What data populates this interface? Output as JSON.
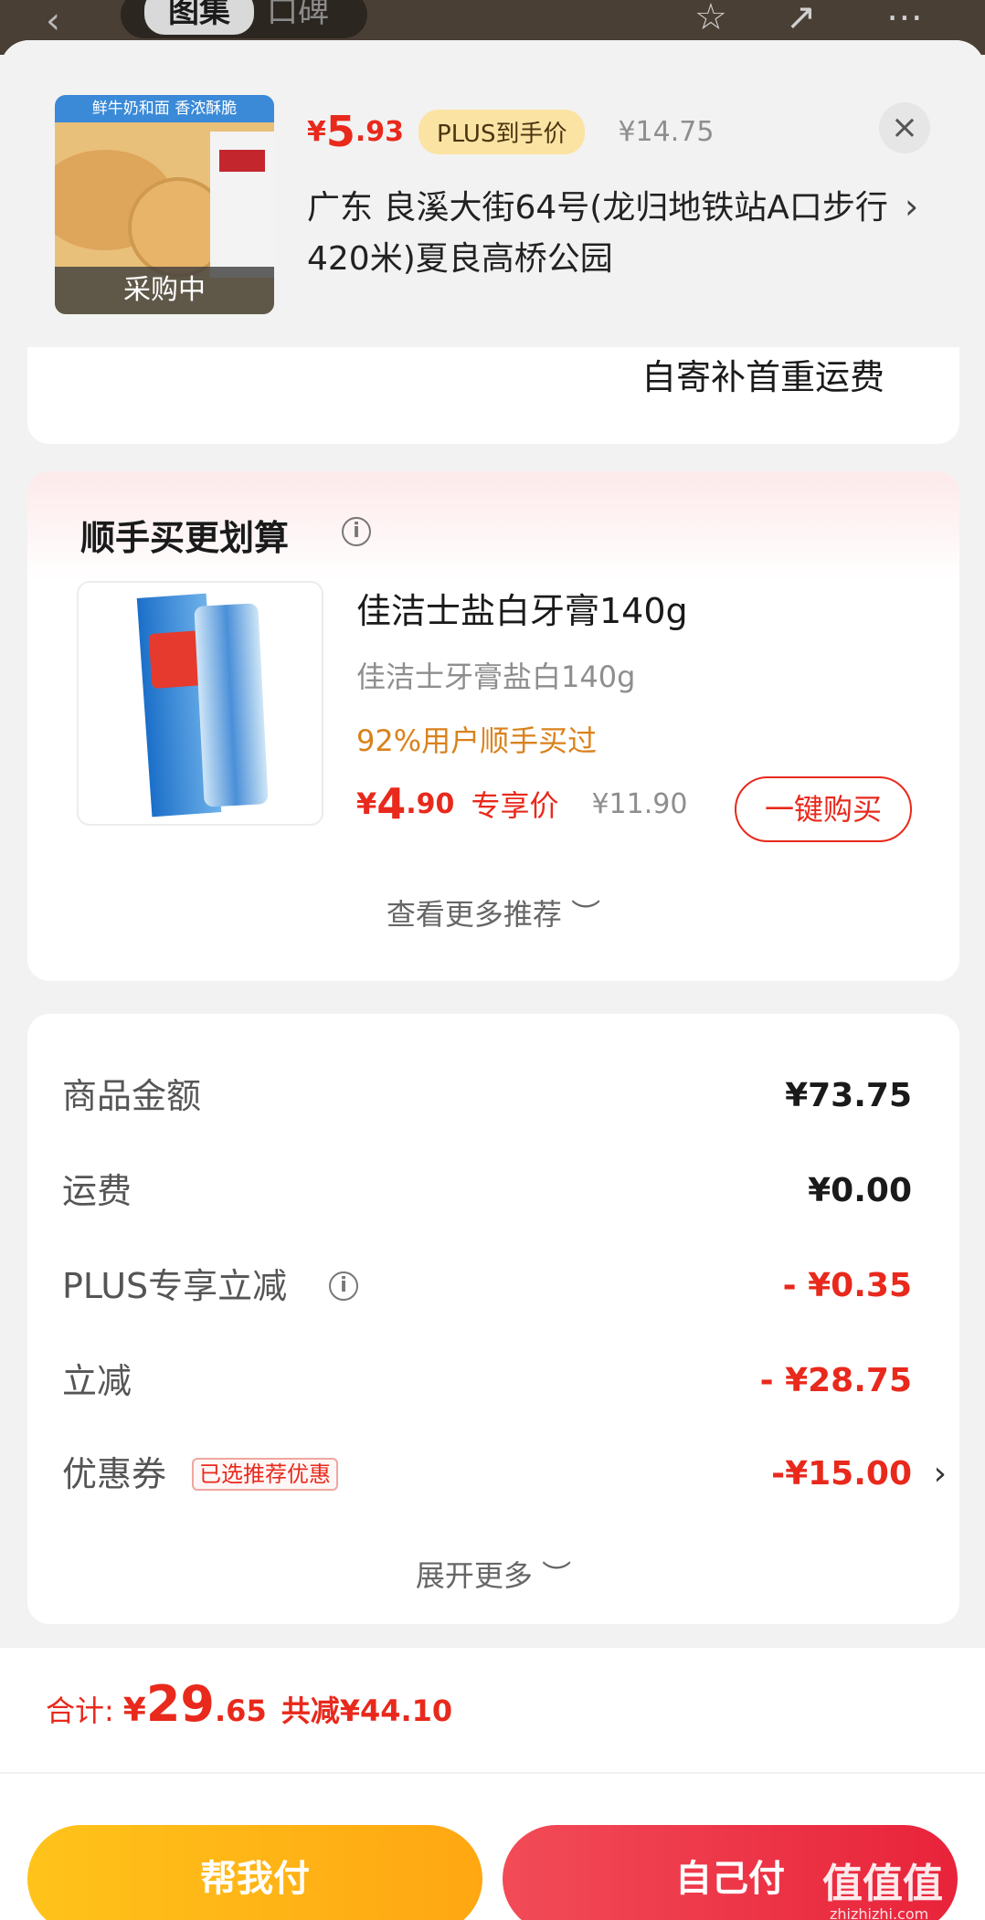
{
  "top": {
    "tab_active": "图集",
    "tab_other": "口碑"
  },
  "header": {
    "thumb_band": "鲜牛奶和面 香浓酥脆",
    "thumb_status": "采购中",
    "price_currency": "¥",
    "price_int": "5",
    "price_dec": ".93",
    "plus_tag": "PLUS到手价",
    "original_price": "¥14.75",
    "address": "广东  良溪大街64号(龙归地铁站A口步行420米)夏良高桥公园",
    "close": "×"
  },
  "freight": {
    "note": "自寄补首重运费"
  },
  "bundle": {
    "title": "顺手买更划算",
    "product_name": "佳洁士盐白牙膏140g",
    "product_sub": "佳洁士牙膏盐白140g",
    "stat": "92%用户顺手买过",
    "price_currency": "¥",
    "price_int": "4",
    "price_dec": ".90",
    "price_tag": "专享价",
    "original_price": "¥11.90",
    "buy_label": "一键购买",
    "more_label": "查看更多推荐 ︶"
  },
  "summary": {
    "rows": [
      {
        "label": "商品金额",
        "value": "¥73.75"
      },
      {
        "label": "运费",
        "value": "¥0.00"
      },
      {
        "label": "PLUS专享立减",
        "value": "- ¥0.35"
      },
      {
        "label": "立减",
        "value": "- ¥28.75"
      },
      {
        "label": "优惠券",
        "value": "-¥15.00"
      }
    ],
    "coupon_tag": "已选推荐优惠",
    "expand_label": "展开更多 ︶"
  },
  "bottom": {
    "total_label": "合计:",
    "total_currency": "¥",
    "total_int": "29",
    "total_dec": ".65",
    "total_save": "共减¥44.10",
    "help_pay": "帮我付",
    "self_pay": "自己付",
    "watermark": "值值值",
    "watermark_sub": "zhizhizhi.com"
  },
  "colors": {
    "accent_red": "#e8291c",
    "help_yellow": "#ffb514",
    "self_red": "#ec2f44"
  }
}
